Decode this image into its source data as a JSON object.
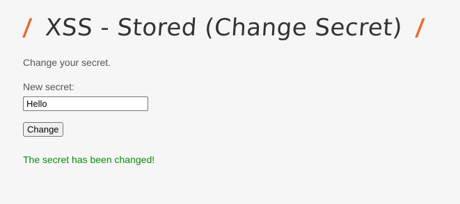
{
  "header": {
    "slash_left": "/",
    "title": "XSS - Stored (Change Secret)",
    "slash_right": "/"
  },
  "form": {
    "intro": "Change your secret.",
    "secret_label": "New secret:",
    "secret_value": "Hello",
    "submit_label": "Change"
  },
  "status": {
    "message": "The secret has been changed!",
    "color": "#0a8a0a"
  },
  "colors": {
    "accent": "#e9692c",
    "background": "#f6f6f6"
  }
}
